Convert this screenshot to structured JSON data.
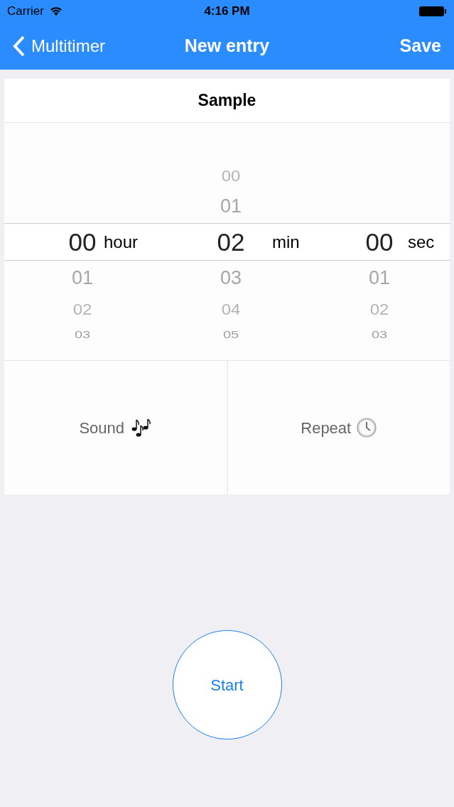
{
  "status_bar": {
    "carrier": "Carrier",
    "time": "4:16 PM"
  },
  "nav_bar": {
    "back": "Multitimer",
    "title": "New entry",
    "action": "Save"
  },
  "entry_name": "Sample",
  "picker": {
    "columns": [
      {
        "selected": "00",
        "unit": "hour",
        "below": [
          "01",
          "02",
          "03"
        ]
      },
      {
        "above": [
          "00",
          "01"
        ],
        "selected": "02",
        "unit": "min",
        "below": [
          "03",
          "04",
          "05"
        ]
      },
      {
        "selected": "00",
        "unit": "sec",
        "below": [
          "01",
          "02",
          "03"
        ]
      }
    ]
  },
  "options": [
    {
      "label": "Sound",
      "kind": "sound"
    },
    {
      "label": "Repeat",
      "kind": "repeat"
    }
  ],
  "start_button": "Start"
}
